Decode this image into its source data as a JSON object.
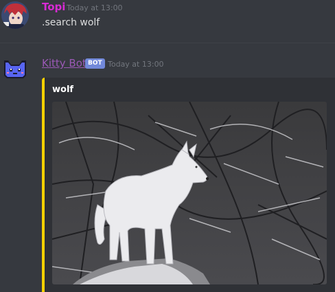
{
  "messages": [
    {
      "username": "Topi",
      "username_color": "#d82bd4",
      "timestamp": "Today at 13:00",
      "content": ".search wolf"
    },
    {
      "username": "Kitty Bot",
      "username_color": "#9b59b6",
      "badge": "BOT",
      "timestamp": "Today at 13:00",
      "embed": {
        "title": "wolf",
        "accent_color": "#f8d100",
        "image_icon": "wolf-photo"
      }
    }
  ]
}
